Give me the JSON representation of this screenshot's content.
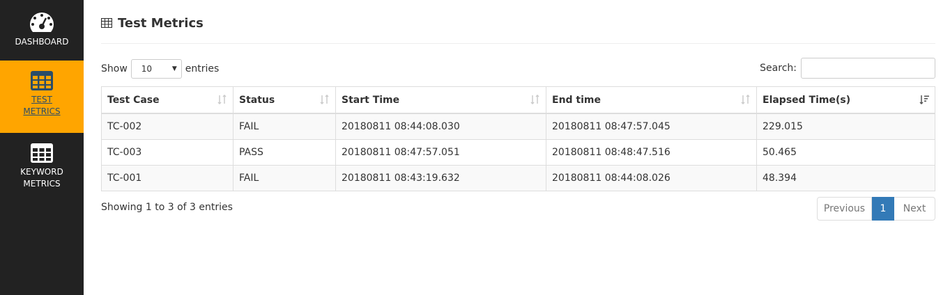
{
  "sidebar": {
    "items": [
      {
        "label_line1": "DASHBOARD",
        "label_line2": "",
        "icon": "dashboard-gauge-icon",
        "active": false
      },
      {
        "label_line1": "TEST",
        "label_line2": "METRICS",
        "icon": "table-icon",
        "active": true
      },
      {
        "label_line1": "KEYWORD",
        "label_line2": "METRICS",
        "icon": "table-icon",
        "active": false
      }
    ],
    "colors": {
      "bg": "#222222",
      "active_bg": "#ffa500"
    }
  },
  "header": {
    "title": "Test Metrics",
    "icon": "table-icon"
  },
  "controls": {
    "show_label": "Show",
    "entries_value": "10",
    "entries_label": "entries",
    "search_label": "Search:",
    "search_value": ""
  },
  "table": {
    "columns": [
      "Test Case",
      "Status",
      "Start Time",
      "End time",
      "Elapsed Time(s)"
    ],
    "rows": [
      [
        "TC-002",
        "FAIL",
        "20180811 08:44:08.030",
        "20180811 08:47:57.045",
        "229.015"
      ],
      [
        "TC-003",
        "PASS",
        "20180811 08:47:57.051",
        "20180811 08:48:47.516",
        "50.465"
      ],
      [
        "TC-001",
        "FAIL",
        "20180811 08:43:19.632",
        "20180811 08:44:08.026",
        "48.394"
      ]
    ],
    "sorted_column": "Elapsed Time(s)",
    "sort_direction": "descending"
  },
  "footer": {
    "info": "Showing 1 to 3 of 3 entries",
    "previous": "Previous",
    "current_page": "1",
    "next": "Next",
    "accent": "#337ab7"
  }
}
